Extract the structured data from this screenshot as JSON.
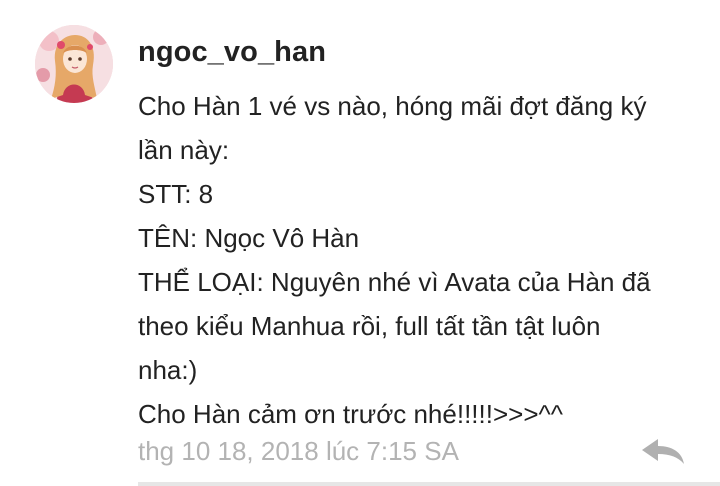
{
  "comment": {
    "username": "ngoc_vo_han",
    "avatar_icon": "anime-girl-avatar",
    "lines": [
      "Cho Hàn 1 vé vs nào, hóng mãi đợt đăng ký",
      "lần này:",
      "STT: 8",
      "TÊN: Ngọc Vô Hàn",
      "THỂ LOẠI: Nguyên nhé vì Avata của Hàn đã",
      "theo kiểu Manhua rồi, full tất tần tật luôn",
      "nha:)",
      "Cho Hàn cảm ơn trước nhé!!!!!>>>^^"
    ],
    "timestamp": "thg 10 18, 2018 lúc 7:15 SA",
    "reply_icon": "reply-arrow-icon"
  },
  "colors": {
    "text": "#222222",
    "timestamp": "#b3b3b3",
    "reply_icon": "#b0b0b0",
    "divider": "#e6e6e6"
  }
}
